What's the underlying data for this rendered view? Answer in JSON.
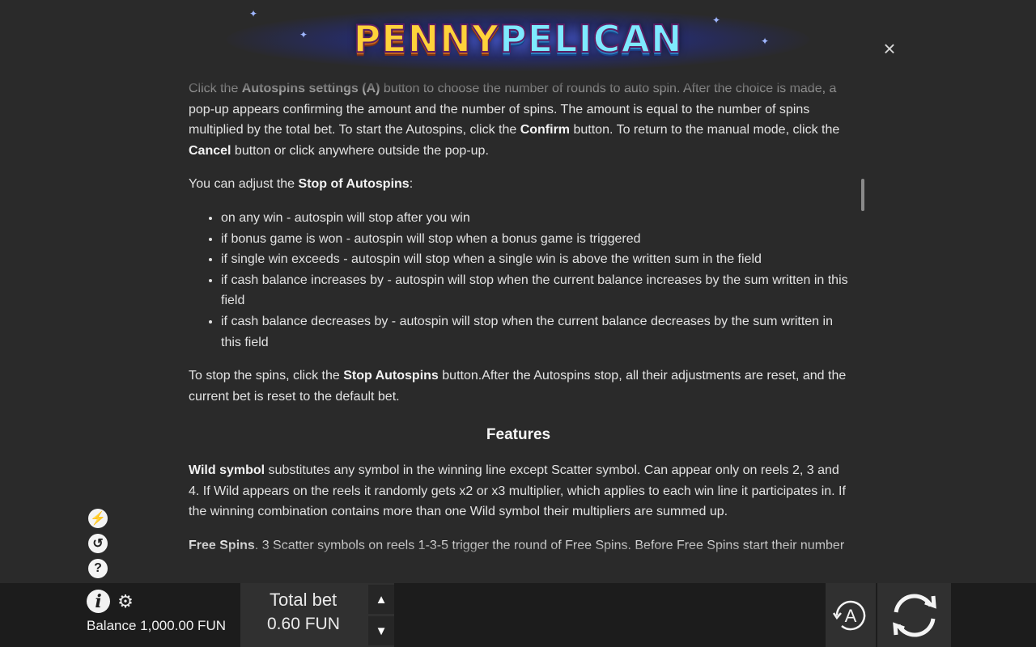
{
  "logo": {
    "part1": "PENNY",
    "part2": "PELICAN"
  },
  "close_symbol": "×",
  "content": {
    "p1": {
      "t1": "Click the ",
      "b1": "Autospins settings (A)",
      "t2": " button to choose the number of rounds to auto spin. After the choice is made, a pop-up appears confirming the amount and the number of spins. The amount is equal to the number of spins multiplied by the total bet. To start the Autospins, click the ",
      "b2": "Confirm",
      "t3": " button. To return to the manual mode, click the ",
      "b3": "Cancel",
      "t4": " button or click anywhere outside the pop-up."
    },
    "p2": {
      "t1": "You can adjust the ",
      "b1": "Stop of Autospins",
      "t2": ":"
    },
    "list": [
      "on any win - autospin will stop after you win",
      "if bonus game is won - autospin will stop when a bonus game is triggered",
      "if single win exceeds - autospin will stop when a single win is above the written sum in the field",
      "if cash balance increases by - autospin will stop when the current balance increases by the sum written in this field",
      "if cash balance decreases by - autospin will stop when the current balance decreases by the sum written in this field"
    ],
    "p3": {
      "t1": "To stop the spins, click the ",
      "b1": "Stop Autospins",
      "t2": " button.After the Autospins stop, all their adjustments are reset, and the current bet is reset to the default bet."
    },
    "features_heading": "Features",
    "p4": {
      "b1": "Wild symbol",
      "t1": " substitutes any symbol in the winning line except Scatter symbol. Can appear only on reels 2, 3 and 4. If Wild appears on the reels it randomly gets x2 or x3 multiplier, which applies to each win line it participates in. If the winning combination contains more than one Wild symbol their multipliers are summed up."
    },
    "p5": {
      "b1": "Free Spins",
      "t1": ". 3 Scatter symbols on reels 1-3-5 trigger the round of Free Spins. Before Free Spins start their number"
    }
  },
  "side_icons": {
    "speed_glyph": "⚡",
    "history_glyph": "↺",
    "help_glyph": "?"
  },
  "bottom": {
    "info_glyph": "i",
    "gear_glyph": "⚙",
    "balance_text": "Balance 1,000.00 FUN",
    "total_bet_label": "Total bet",
    "total_bet_value": "0.60 FUN",
    "bet_up_glyph": "▲",
    "bet_down_glyph": "▼",
    "autospin_letter": "A"
  }
}
